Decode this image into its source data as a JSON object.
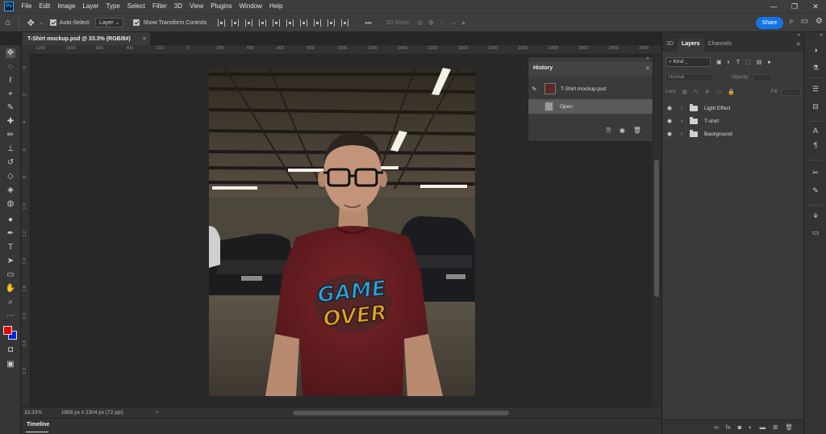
{
  "app": {
    "logo": "Ps"
  },
  "menu": [
    "File",
    "Edit",
    "Image",
    "Layer",
    "Type",
    "Select",
    "Filter",
    "3D",
    "View",
    "Plugins",
    "Window",
    "Help"
  ],
  "window_controls": {
    "minimize": "—",
    "restore": "❐",
    "close": "✕"
  },
  "options_bar": {
    "auto_select_label": "Auto-Select:",
    "auto_select_target": "Layer",
    "show_transform_label": "Show Transform Controls",
    "more": "•••",
    "mode_3d_label": "3D Mode:",
    "share_label": "Share"
  },
  "document_tab": {
    "title": "T-Shirt mockup.psd @ 33.3% (RGB/8#)",
    "close": "×"
  },
  "ruler_top": [
    "1200",
    "1000",
    "800",
    "400",
    "200",
    "0",
    "200",
    "400",
    "600",
    "800",
    "1000",
    "1200",
    "1400",
    "1600",
    "1800",
    "2000",
    "2200",
    "2400",
    "2600",
    "2800",
    "3000"
  ],
  "ruler_left": [
    "0",
    "2",
    "4",
    "6",
    "8",
    "1 0",
    "1 2",
    "1 4",
    "1 6",
    "1 8",
    "2 0",
    "2 2"
  ],
  "status": {
    "zoom": "33.33%",
    "doc_info": "1856 px x 2304 px (72 ppi)",
    "arrow": ">"
  },
  "timeline": {
    "label": "Timeline"
  },
  "history_panel": {
    "title": "History",
    "collapse": "»",
    "items": [
      {
        "label": "T-Shirt mockup.psd",
        "selected": false
      },
      {
        "label": "Open",
        "selected": true
      }
    ]
  },
  "right_panel": {
    "tabs": [
      "3D",
      "Layers",
      "Channels"
    ],
    "active_tab": "Layers",
    "collapse": "»",
    "kind_label": "Kind",
    "blend_mode": "Normal",
    "opacity_label": "Opacity:",
    "lock_label": "Lock:",
    "fill_label": "Fill:",
    "layers": [
      {
        "name": "Light Effect"
      },
      {
        "name": "T-shirt"
      },
      {
        "name": "Background"
      }
    ],
    "bottom_icons": [
      "link",
      "fx",
      "mask",
      "adjustment",
      "group",
      "new-layer",
      "delete"
    ]
  },
  "print": {
    "line1": "GAME",
    "line2": "OVER"
  },
  "colors": {
    "foreground": "#e80000",
    "background": "#0026e0",
    "accent": "#1473e6",
    "shirt": "#6b1e22"
  }
}
